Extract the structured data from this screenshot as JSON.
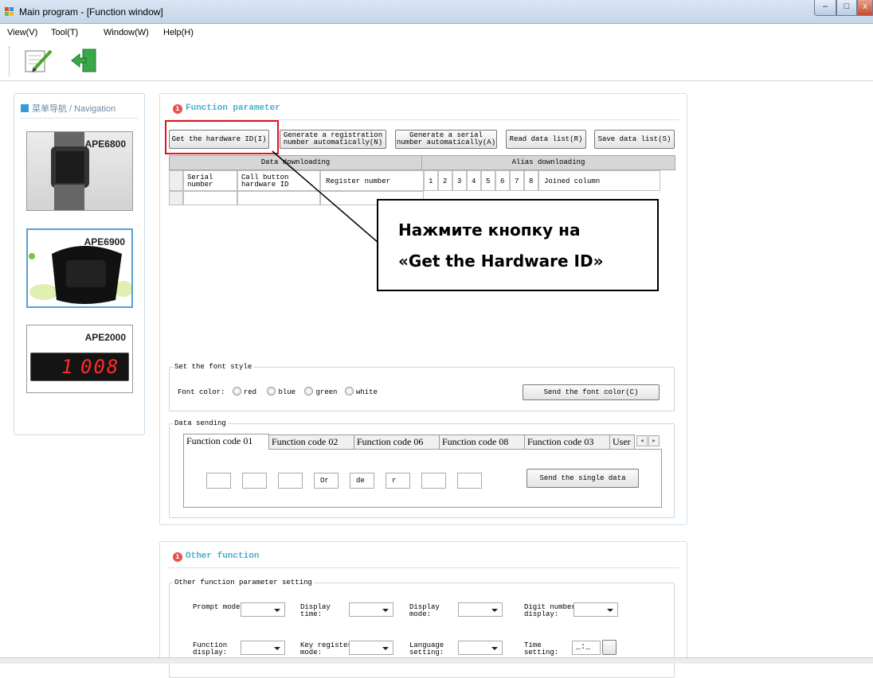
{
  "window": {
    "title": "Main program - [Function window]",
    "minimize": "–",
    "maximize": "□",
    "close": "x"
  },
  "menu": {
    "items": [
      "View(V)",
      "Tool(T)",
      "Window(W)",
      "Help(H)"
    ]
  },
  "toolbar": {
    "buttons": [
      "edit-icon",
      "exit-icon"
    ]
  },
  "nav": {
    "title": "菜单导航 / Navigation",
    "cards": [
      {
        "label": "APE6800"
      },
      {
        "label": "APE6900"
      },
      {
        "label": "APE2000",
        "display": "008",
        "display_prefix": "1"
      }
    ]
  },
  "function_parameter": {
    "title": "Function parameter",
    "buttons": {
      "get_hw_id": "Get the hardware ID(I)",
      "gen_reg_1": "Generate a registration",
      "gen_reg_2": "number automatically(N)",
      "gen_serial_1": "Generate a serial",
      "gen_serial_2": "number automatically(A)",
      "read_list": "Read data list(R)",
      "save_list": "Save data list(S)"
    },
    "headers": {
      "data_downloading": "Data downloading",
      "alias_downloading": "Alias downloading"
    },
    "columns": {
      "serial_1": "Serial",
      "serial_2": "number",
      "call_1": "Call button",
      "call_2": "hardware ID",
      "register": "Register number",
      "nums": [
        "1",
        "2",
        "3",
        "4",
        "5",
        "6",
        "7",
        "8"
      ],
      "joined": "Joined column"
    },
    "font_style": {
      "legend": "Set the font style",
      "label": "Font color:",
      "options": [
        "red",
        "blue",
        "green",
        "white"
      ],
      "send_button": "Send the font color(C)"
    },
    "data_sending": {
      "legend": "Data sending",
      "tabs": [
        "Function code 01",
        "Function code 02",
        "Function code 06",
        "Function code 08",
        "Function code 03",
        "User"
      ],
      "fields": [
        "",
        "",
        "",
        "Or",
        "de",
        "r",
        "",
        ""
      ],
      "send_button": "Send the single data"
    }
  },
  "other_function": {
    "title": "Other function",
    "legend": "Other function parameter setting",
    "row1": [
      {
        "l1": "Prompt mode:",
        "l2": ""
      },
      {
        "l1": "Display",
        "l2": "time:"
      },
      {
        "l1": "Display",
        "l2": "mode:"
      },
      {
        "l1": "Digit number",
        "l2": "display:"
      }
    ],
    "row2": [
      {
        "l1": "Function",
        "l2": "display:"
      },
      {
        "l1": "Key register",
        "l2": "mode:"
      },
      {
        "l1": "Language",
        "l2": "setting:"
      },
      {
        "l1": "Time",
        "l2": "setting:"
      }
    ],
    "time_value": "_:_"
  },
  "callout": {
    "line1": "Нажмите кнопку на",
    "line2": "«Get the Hardware ID»"
  },
  "colors": {
    "accent": "#47b0c9",
    "highlight": "#e0141e",
    "section_dot": "#e2554d"
  }
}
